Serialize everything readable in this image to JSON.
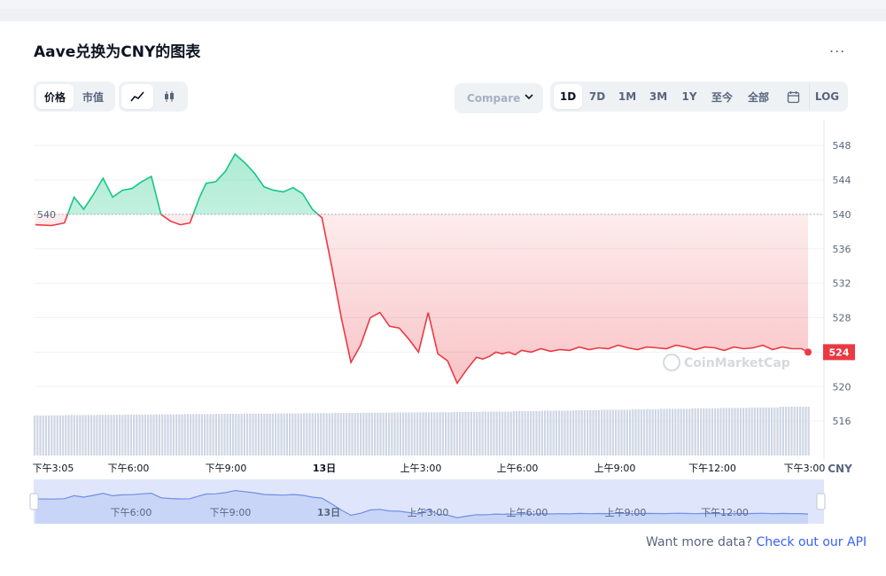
{
  "header": {
    "title": "Aave兑换为CNY的图表",
    "more_label": "..."
  },
  "toolbar": {
    "type_tabs": [
      {
        "label": "价格",
        "active": true
      },
      {
        "label": "市值",
        "active": false
      }
    ],
    "style_icons": [
      "line-chart-icon",
      "candlestick-icon"
    ],
    "compare_label": "Compare",
    "ranges": [
      {
        "label": "1D",
        "active": true
      },
      {
        "label": "7D",
        "active": false
      },
      {
        "label": "1M",
        "active": false
      },
      {
        "label": "3M",
        "active": false
      },
      {
        "label": "1Y",
        "active": false
      },
      {
        "label": "至今",
        "active": false
      },
      {
        "label": "全部",
        "active": false
      }
    ],
    "calendar_icon": "calendar-icon",
    "log_label": "LOG"
  },
  "colors": {
    "up": "#16c784",
    "down": "#ea3943",
    "grid": "#eff2f5",
    "axis_text": "#58667e",
    "volume": "#cfd6e4",
    "nav_fill": "#dfe6fb",
    "nav_line": "#6f8ee8"
  },
  "chart_data": {
    "type": "line",
    "currency_label": "CNY",
    "reference_value": 540,
    "reference_label": "540",
    "current_value": 524,
    "current_label": "524",
    "ylim": [
      512,
      551
    ],
    "y_ticks": [
      516,
      520,
      524,
      528,
      532,
      536,
      540,
      544,
      548
    ],
    "x_ticks": [
      "下午3:05",
      "下午6:00",
      "下午9:00",
      "13日",
      "上午3:00",
      "上午6:00",
      "上午9:00",
      "下午12:00",
      "下午3:00"
    ],
    "navigator_ticks": [
      "下午6:00",
      "下午9:00",
      "13日",
      "上午3:00",
      "上午6:00",
      "上午9:00",
      "下午12:00"
    ],
    "watermark": "CoinMarketCap",
    "x_hours": [
      0.0,
      0.5,
      0.9,
      1.2,
      1.5,
      1.8,
      2.1,
      2.4,
      2.7,
      3.0,
      3.3,
      3.6,
      3.9,
      4.2,
      4.5,
      4.8,
      5.1,
      5.3,
      5.6,
      5.9,
      6.2,
      6.5,
      6.8,
      7.1,
      7.4,
      7.7,
      8.0,
      8.3,
      8.6,
      8.9,
      9.2,
      9.5,
      9.8,
      10.1,
      10.4,
      10.7,
      11.0,
      11.3,
      11.6,
      11.9,
      12.2,
      12.5,
      12.8,
      13.1,
      13.4,
      13.7,
      13.9,
      14.1,
      14.3,
      14.5,
      14.7,
      14.9,
      15.1,
      15.4,
      15.7,
      16.0,
      16.3,
      16.6,
      16.9,
      17.2,
      17.5,
      17.8,
      18.1,
      18.4,
      18.7,
      19.0,
      19.3,
      19.6,
      19.9,
      20.2,
      20.5,
      20.8,
      21.1,
      21.4,
      21.7,
      22.0,
      22.3,
      22.6,
      22.9,
      23.2,
      23.5,
      23.8,
      24.0
    ],
    "values": [
      538.8,
      538.7,
      539.0,
      542.0,
      540.6,
      542.3,
      544.2,
      542.0,
      542.8,
      543.0,
      543.8,
      544.4,
      540.0,
      539.2,
      538.8,
      539.0,
      542.0,
      543.6,
      543.8,
      545.0,
      547.0,
      546.0,
      544.8,
      543.2,
      542.8,
      542.6,
      543.1,
      542.4,
      540.6,
      539.6,
      534.0,
      528.0,
      522.8,
      524.8,
      528.0,
      528.6,
      527.0,
      526.8,
      525.5,
      524.0,
      528.6,
      523.8,
      523.0,
      520.4,
      522.0,
      523.4,
      523.2,
      523.5,
      524.0,
      523.8,
      524.0,
      523.7,
      524.2,
      524.0,
      524.4,
      524.1,
      524.3,
      524.2,
      524.6,
      524.3,
      524.5,
      524.4,
      524.8,
      524.5,
      524.3,
      524.6,
      524.5,
      524.4,
      524.8,
      524.6,
      524.3,
      524.6,
      524.5,
      524.2,
      524.6,
      524.4,
      524.5,
      524.8,
      524.3,
      524.6,
      524.4,
      524.4,
      524.0
    ],
    "volume_relative": [
      0.25,
      0.28,
      0.3,
      0.32,
      0.34,
      0.36,
      0.38,
      0.4,
      0.42,
      0.44,
      0.46,
      0.48,
      0.5,
      0.52,
      0.55,
      0.58,
      0.62,
      0.66,
      0.7,
      0.74,
      0.78,
      0.82,
      0.86,
      0.9,
      0.94,
      1.0
    ]
  },
  "footer": {
    "api_prefix": "Want more data? ",
    "api_link": "Check out our API"
  }
}
